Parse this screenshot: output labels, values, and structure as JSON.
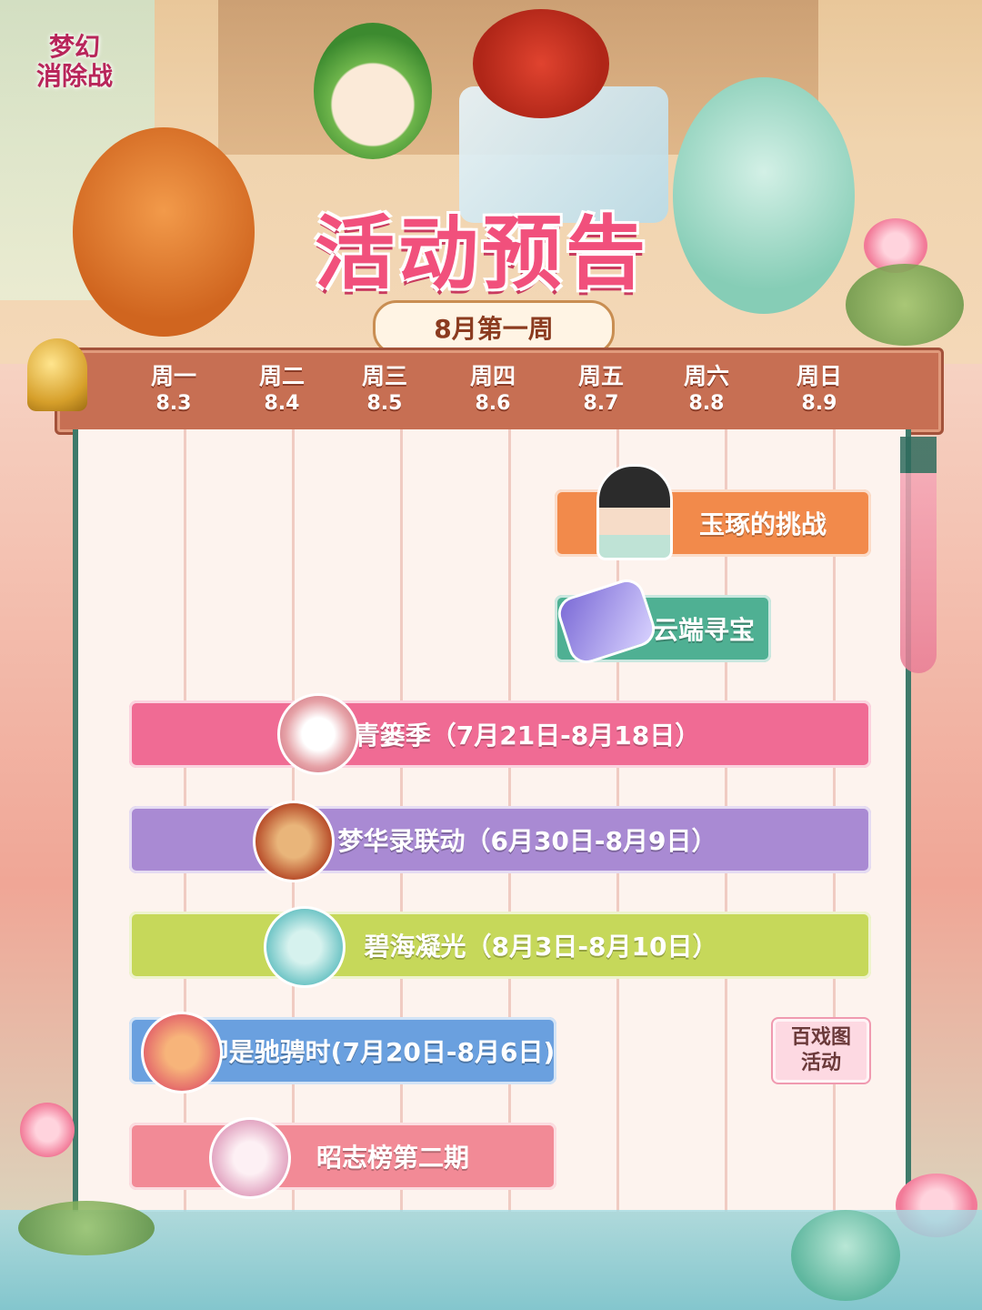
{
  "logo": {
    "line1": "梦幻",
    "line2": "消除战"
  },
  "title": "活动预告",
  "subtitle": "8月第一周",
  "days": [
    {
      "name": "周一",
      "date": "8.3"
    },
    {
      "name": "周二",
      "date": "8.4"
    },
    {
      "name": "周三",
      "date": "8.5"
    },
    {
      "name": "周四",
      "date": "8.6"
    },
    {
      "name": "周五",
      "date": "8.7"
    },
    {
      "name": "周六",
      "date": "8.8"
    },
    {
      "name": "周日",
      "date": "8.9"
    }
  ],
  "events": {
    "yuzhuo": "玉琢的挑战",
    "yunduan": "云端寻宝",
    "qingli": "青篓季（7月21日-8月18日）",
    "menghua": "梦华录联动（6月30日-8月9日）",
    "bihai": "碧海凝光（8月3日-8月10日）",
    "jishi": "即是驰骋时(7月20日-8月6日)",
    "zhaozhi": "昭志榜第二期",
    "baixi_line1": "百戏图",
    "baixi_line2": "活动"
  },
  "colors": {
    "title": "#f1507c",
    "header_bar": "#c76f53",
    "yuzhuo": "#f28a4b",
    "yunduan": "#4fb093",
    "qingli": "#f06b94",
    "menghua": "#a98ad3",
    "bihai": "#c6d85a",
    "jishi": "#6aa0df",
    "zhaozhi": "#f28a96"
  }
}
